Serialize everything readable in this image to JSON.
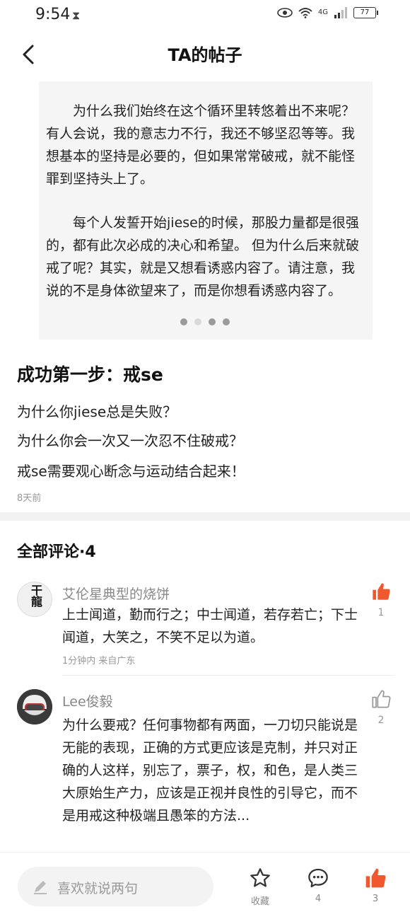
{
  "status_bar": {
    "time": "9:54",
    "network": "4G",
    "battery": "77"
  },
  "header": {
    "title": "TA的帖子"
  },
  "image_card": {
    "paragraph1": "为什么我们始终在这个循环里转悠着出不来呢？有人会说，我的意志力不行，我还不够坚忍等等。我想基本的坚持是必要的，但如果常常破戒，就不能怪罪到坚持头上了。",
    "paragraph2": "每个人发誓开始jiese的时候，那股力量都是很强的，都有此次必成的决心和希望。 但为什么后来就破戒了呢？其实，就是又想看诱惑内容了。请注意，我说的不是身体欲望来了，而是你想看诱惑内容了。",
    "page_count": 4,
    "current_page": 2
  },
  "post": {
    "title": "成功第一步：戒se",
    "lines": [
      "为什么你jiese总是失败？",
      "为什么你会一次又一次忍不住破戒？",
      "戒se需要观心断念与运动结合起来！"
    ],
    "time": "8天前"
  },
  "comments_section": {
    "title": "全部评论·4",
    "comments": [
      {
        "username": "艾伦星典型的烧饼",
        "text": "上士闻道，勤而行之；中士闻道，若存若亡；下士闻道，大笑之，不笑不足以为道。",
        "meta": "1分钟内 来自广东",
        "likes": "1",
        "liked": true,
        "avatar_text": "干龍"
      },
      {
        "username": "Lee俊毅",
        "text": "为什么要戒？任何事物都有两面，一刀切只能说是无能的表现，正确的方式更应该是克制，并只对正确的人这样，别忘了，票子，权，和色，是人类三大原始生产力，应该是正视并良性的引导它，而不是用戒这种极端且愚笨的方法...",
        "likes": "2",
        "liked": false
      }
    ]
  },
  "bottom_bar": {
    "input_placeholder": "喜欢就说两句",
    "favorite_label": "收藏",
    "comment_count": "4",
    "like_count": "3"
  },
  "colors": {
    "accent": "#f0592d",
    "gray_text": "#999999"
  }
}
